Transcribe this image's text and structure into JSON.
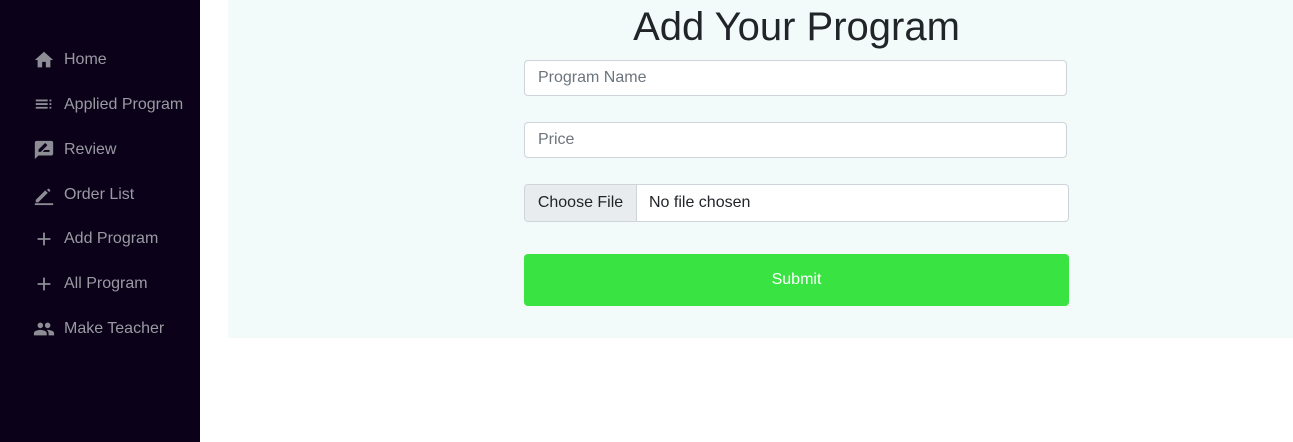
{
  "sidebar": {
    "items": [
      {
        "label": "Home",
        "icon": "home-icon"
      },
      {
        "label": "Applied Program",
        "icon": "list-icon"
      },
      {
        "label": "Review",
        "icon": "rate-review-icon"
      },
      {
        "label": "Order List",
        "icon": "edit-icon"
      },
      {
        "label": "Add Program",
        "icon": "plus-icon"
      },
      {
        "label": "All Program",
        "icon": "plus-icon"
      },
      {
        "label": "Make Teacher",
        "icon": "people-icon"
      }
    ]
  },
  "form": {
    "title": "Add Your Program",
    "program_name_placeholder": "Program Name",
    "price_placeholder": "Price",
    "file_button_label": "Choose File",
    "file_status": "No file chosen",
    "submit_label": "Submit"
  },
  "colors": {
    "sidebar_bg": "#0b0119",
    "main_bg": "#f3fbfa",
    "submit_bg": "#38e342"
  }
}
